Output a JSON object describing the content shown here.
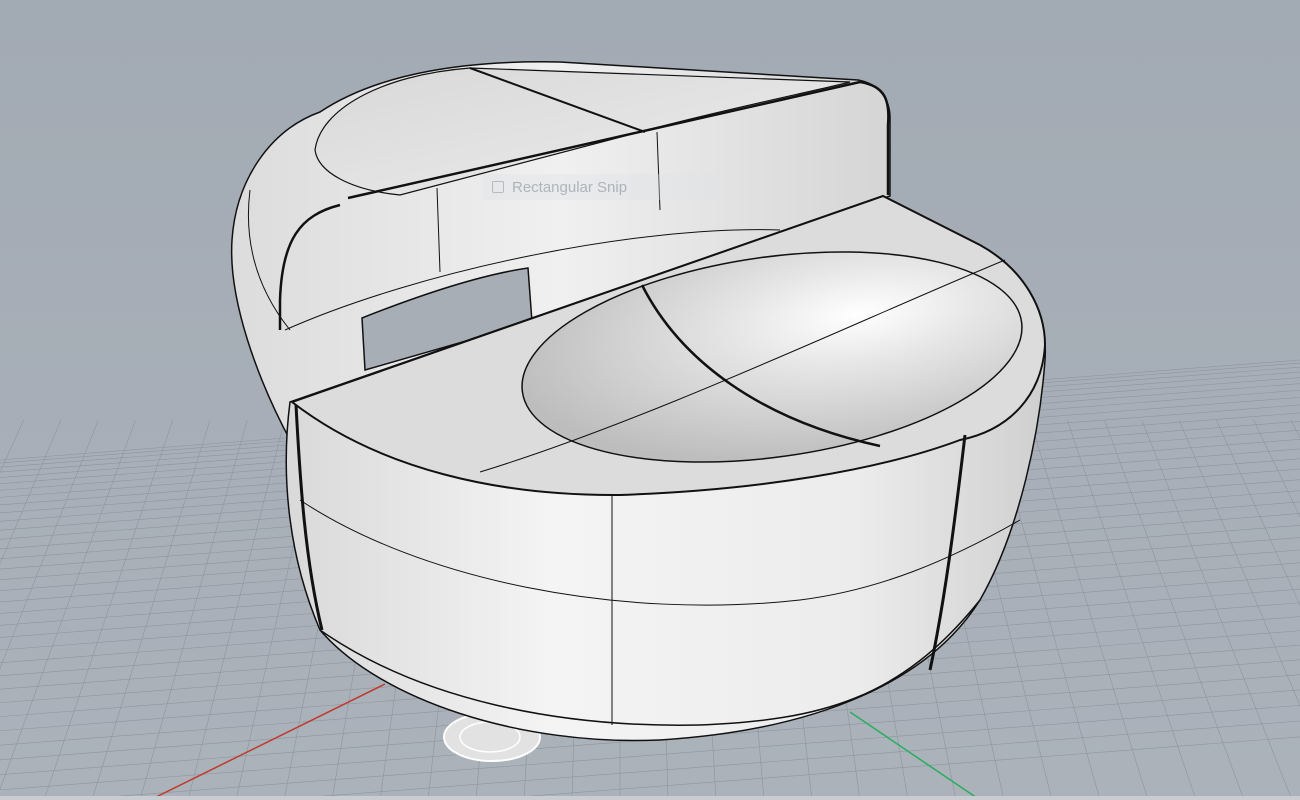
{
  "app": {
    "viewport": "3D perspective viewport",
    "view_mode": "shaded"
  },
  "overlay": {
    "snip_label": "Rectangular Snip",
    "snip_icon": "scissors-icon"
  },
  "colors": {
    "viewport_background": "#a6aeb6",
    "grid_line": "#8d959e",
    "x_axis": "#c0392b",
    "y_axis": "#27ae60",
    "model_surface": "#e7e7e7",
    "model_edge": "#111111"
  }
}
